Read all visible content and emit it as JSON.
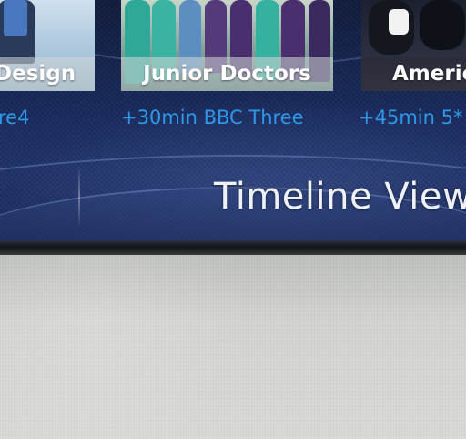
{
  "programmes": [
    {
      "title": "Design",
      "channel": "re4"
    },
    {
      "title": "Junior Doctors",
      "channel": "+30min BBC Three"
    },
    {
      "title": "Americ",
      "channel": "+45min 5*"
    }
  ],
  "view_title": "Timeline View",
  "colors": {
    "channel_text": "#2f97e8",
    "caption_text": "#ffffff",
    "screen_bg": "#16285a",
    "wall": "#d2d3d0"
  }
}
